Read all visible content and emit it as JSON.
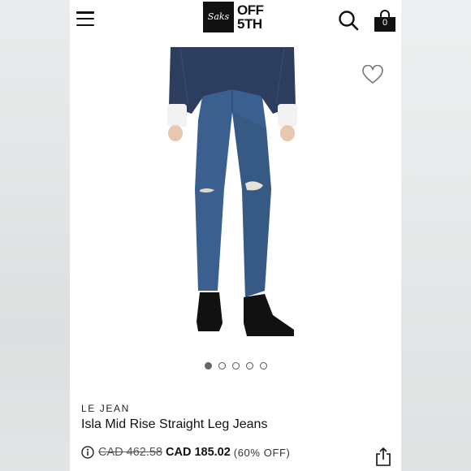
{
  "header": {
    "menu_icon": "hamburger-menu-icon",
    "logo_mark": "Saks",
    "logo_line1": "OFF",
    "logo_line2": "5TH",
    "search_icon": "search-icon",
    "bag_icon": "shopping-bag-icon",
    "bag_count": "0"
  },
  "gallery": {
    "image": "model wearing distressed straight leg jeans with denim jacket and black ankle boots",
    "wishlist_icon": "heart-icon",
    "dot_count": 5,
    "active_index": 0
  },
  "product": {
    "brand": "LE JEAN",
    "title": "Isla Mid Rise Straight Leg Jeans",
    "original_price": "CAD 462.58",
    "sale_price": "CAD 185.02",
    "discount": "(60% OFF)",
    "info_icon": "info-icon",
    "share_icon": "share-icon"
  },
  "colors": {
    "background": "#ffffff",
    "text": "#111111",
    "denim": "#3b5f8f",
    "jacket": "#2c3d5e"
  }
}
